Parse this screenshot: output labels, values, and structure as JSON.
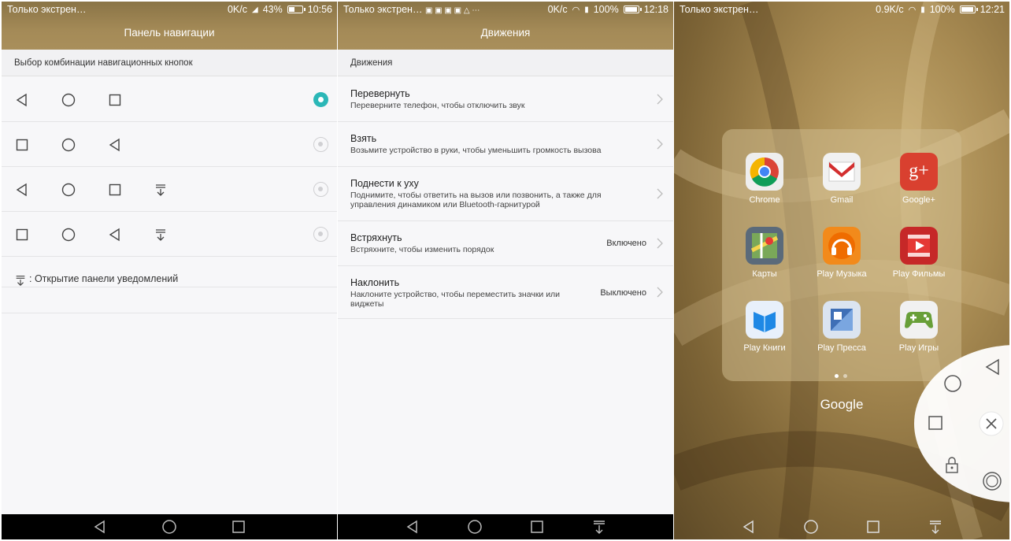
{
  "panel1": {
    "status": {
      "carrier": "Только экстрен…",
      "speed": "0K/c",
      "battery": "43%",
      "battery_level": 0.43,
      "time": "10:56"
    },
    "title": "Панель навигации",
    "section": "Выбор комбинации навигационных кнопок",
    "options": [
      {
        "buttons": [
          "back-icon",
          "home-icon",
          "recent-icon"
        ],
        "selected": true
      },
      {
        "buttons": [
          "recent-icon",
          "home-icon",
          "back-icon"
        ],
        "selected": false
      },
      {
        "buttons": [
          "back-icon",
          "home-icon",
          "recent-icon",
          "notification-pull-icon"
        ],
        "selected": false
      },
      {
        "buttons": [
          "recent-icon",
          "home-icon",
          "back-icon",
          "notification-pull-icon"
        ],
        "selected": false
      }
    ],
    "legend": ": Открытие панели уведомлений"
  },
  "panel2": {
    "status": {
      "carrier": "Только экстрен…",
      "speed": "0K/c",
      "battery": "100%",
      "battery_level": 1.0,
      "time": "12:18"
    },
    "title": "Движения",
    "section": "Движения",
    "items": [
      {
        "title": "Перевернуть",
        "subtitle": "Переверните телефон, чтобы отключить звук",
        "value": ""
      },
      {
        "title": "Взять",
        "subtitle": "Возьмите устройство в руки, чтобы уменьшить громкость вызова",
        "value": ""
      },
      {
        "title": "Поднести к уху",
        "subtitle": "Поднимите, чтобы ответить на вызов или позвонить, а также для управления динамиком или Bluetooth-гарнитурой",
        "value": ""
      },
      {
        "title": "Встряхнуть",
        "subtitle": "Встряхните, чтобы изменить порядок",
        "value": "Включено"
      },
      {
        "title": "Наклонить",
        "subtitle": "Наклоните устройство, чтобы переместить значки или виджеты",
        "value": "Выключено"
      }
    ]
  },
  "panel3": {
    "status": {
      "carrier": "Только экстрен…",
      "speed": "0.9K/c",
      "battery": "100%",
      "battery_level": 1.0,
      "time": "12:21"
    },
    "apps": [
      {
        "label": "Chrome",
        "icon": "chrome-icon"
      },
      {
        "label": "Gmail",
        "icon": "gmail-icon"
      },
      {
        "label": "Google+",
        "icon": "google-plus-icon"
      },
      {
        "label": "Карты",
        "icon": "maps-icon"
      },
      {
        "label": "Play Музыка",
        "icon": "play-music-icon"
      },
      {
        "label": "Play Фильмы",
        "icon": "play-movies-icon"
      },
      {
        "label": "Play Книги",
        "icon": "play-books-icon"
      },
      {
        "label": "Play Пресса",
        "icon": "play-newsstand-icon"
      },
      {
        "label": "Play Игры",
        "icon": "play-games-icon"
      }
    ],
    "folder_name": "Google",
    "page_dots": 2,
    "active_page": 1
  },
  "colors": {
    "accent": "#2bb7b7",
    "header": "#a48a57"
  }
}
